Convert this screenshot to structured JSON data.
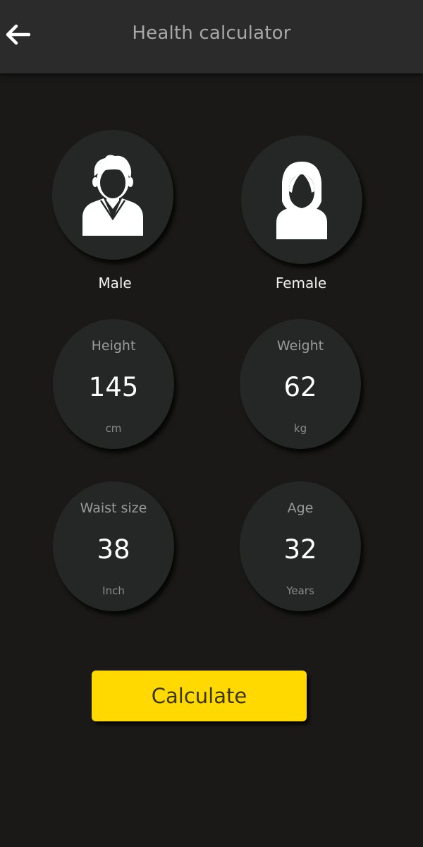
{
  "header": {
    "title": "Health calculator",
    "back_icon": "arrow-left-icon"
  },
  "gender": {
    "male": {
      "label": "Male",
      "icon": "male-avatar-icon"
    },
    "female": {
      "label": "Female",
      "icon": "female-avatar-icon"
    }
  },
  "stats": {
    "height": {
      "label": "Height",
      "value": "145",
      "unit": "cm"
    },
    "weight": {
      "label": "Weight",
      "value": "62",
      "unit": "kg"
    },
    "waist": {
      "label": "Waist size",
      "value": "38",
      "unit": "Inch"
    },
    "age": {
      "label": "Age",
      "value": "32",
      "unit": "Years"
    }
  },
  "calculate_label": "Calculate",
  "colors": {
    "background": "#1a1918",
    "topbar": "#2b2b2b",
    "card": "#252727",
    "accent": "#ffd900"
  }
}
